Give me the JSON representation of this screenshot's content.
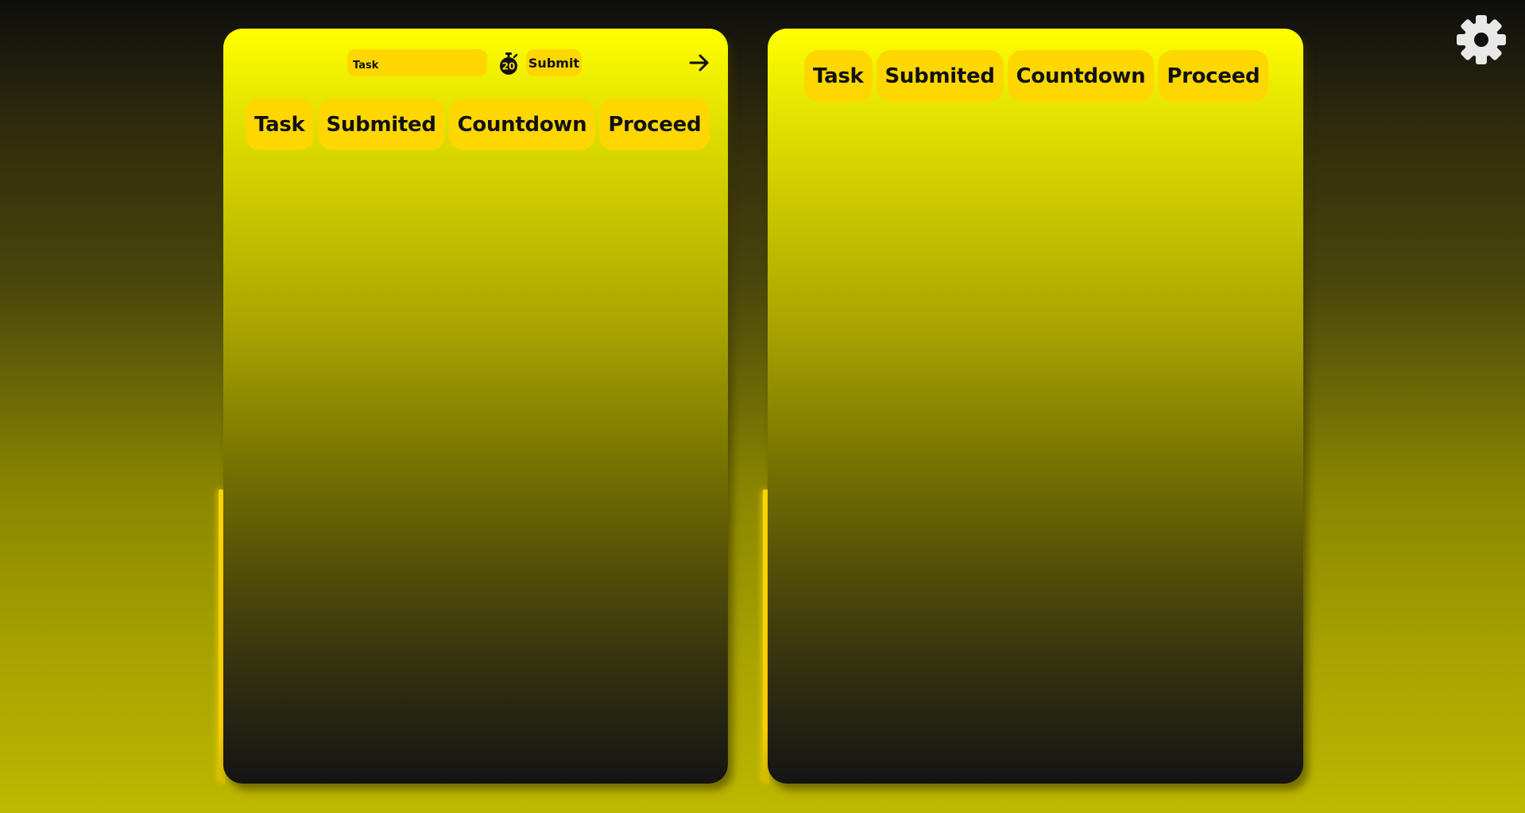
{
  "left_panel": {
    "toolbar": {
      "task_placeholder": "Task",
      "timer_value": "20",
      "submit_label": "Submit",
      "next_icon": "arrow-right-icon"
    },
    "tabs": [
      "Task",
      "Submited",
      "Countdown",
      "Proceed"
    ]
  },
  "right_panel": {
    "tabs": [
      "Task",
      "Submited",
      "Countdown",
      "Proceed"
    ]
  },
  "settings": {
    "icon": "gear-icon"
  },
  "colors": {
    "accent": "#ffd700",
    "panel_top": "#ffff00",
    "panel_bottom": "#141414",
    "text": "#111111",
    "gear": "#e8e8e8"
  }
}
